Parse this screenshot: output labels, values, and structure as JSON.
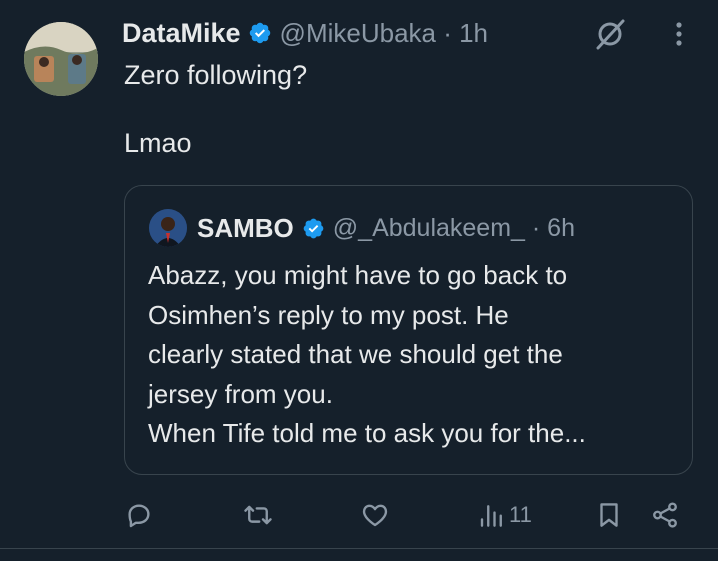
{
  "tweet": {
    "author_name": "DataMike",
    "handle_time": "@MikeUbaka · 1h",
    "text": "Zero following?\n\nLmao"
  },
  "quote": {
    "author_name": "SAMBO",
    "handle_time": "@_Abdulakeem_ · 6h",
    "text": "Abazz, you might have to go back to\nOsimhen’s reply to my post. He\nclearly stated that we should get the\njersey from you.\nWhen Tife told me to ask you for the..."
  },
  "actions": {
    "views_count": "11"
  },
  "icons": [
    "verified-badge-icon",
    "grok-icon",
    "more-icon",
    "reply-icon",
    "retweet-icon",
    "like-icon",
    "views-icon",
    "bookmark-icon",
    "share-icon"
  ],
  "colors": {
    "background": "#15202b",
    "text": "#e7e9ea",
    "muted": "#8b98a5",
    "verified": "#1d9bf0",
    "border": "#38444d"
  }
}
